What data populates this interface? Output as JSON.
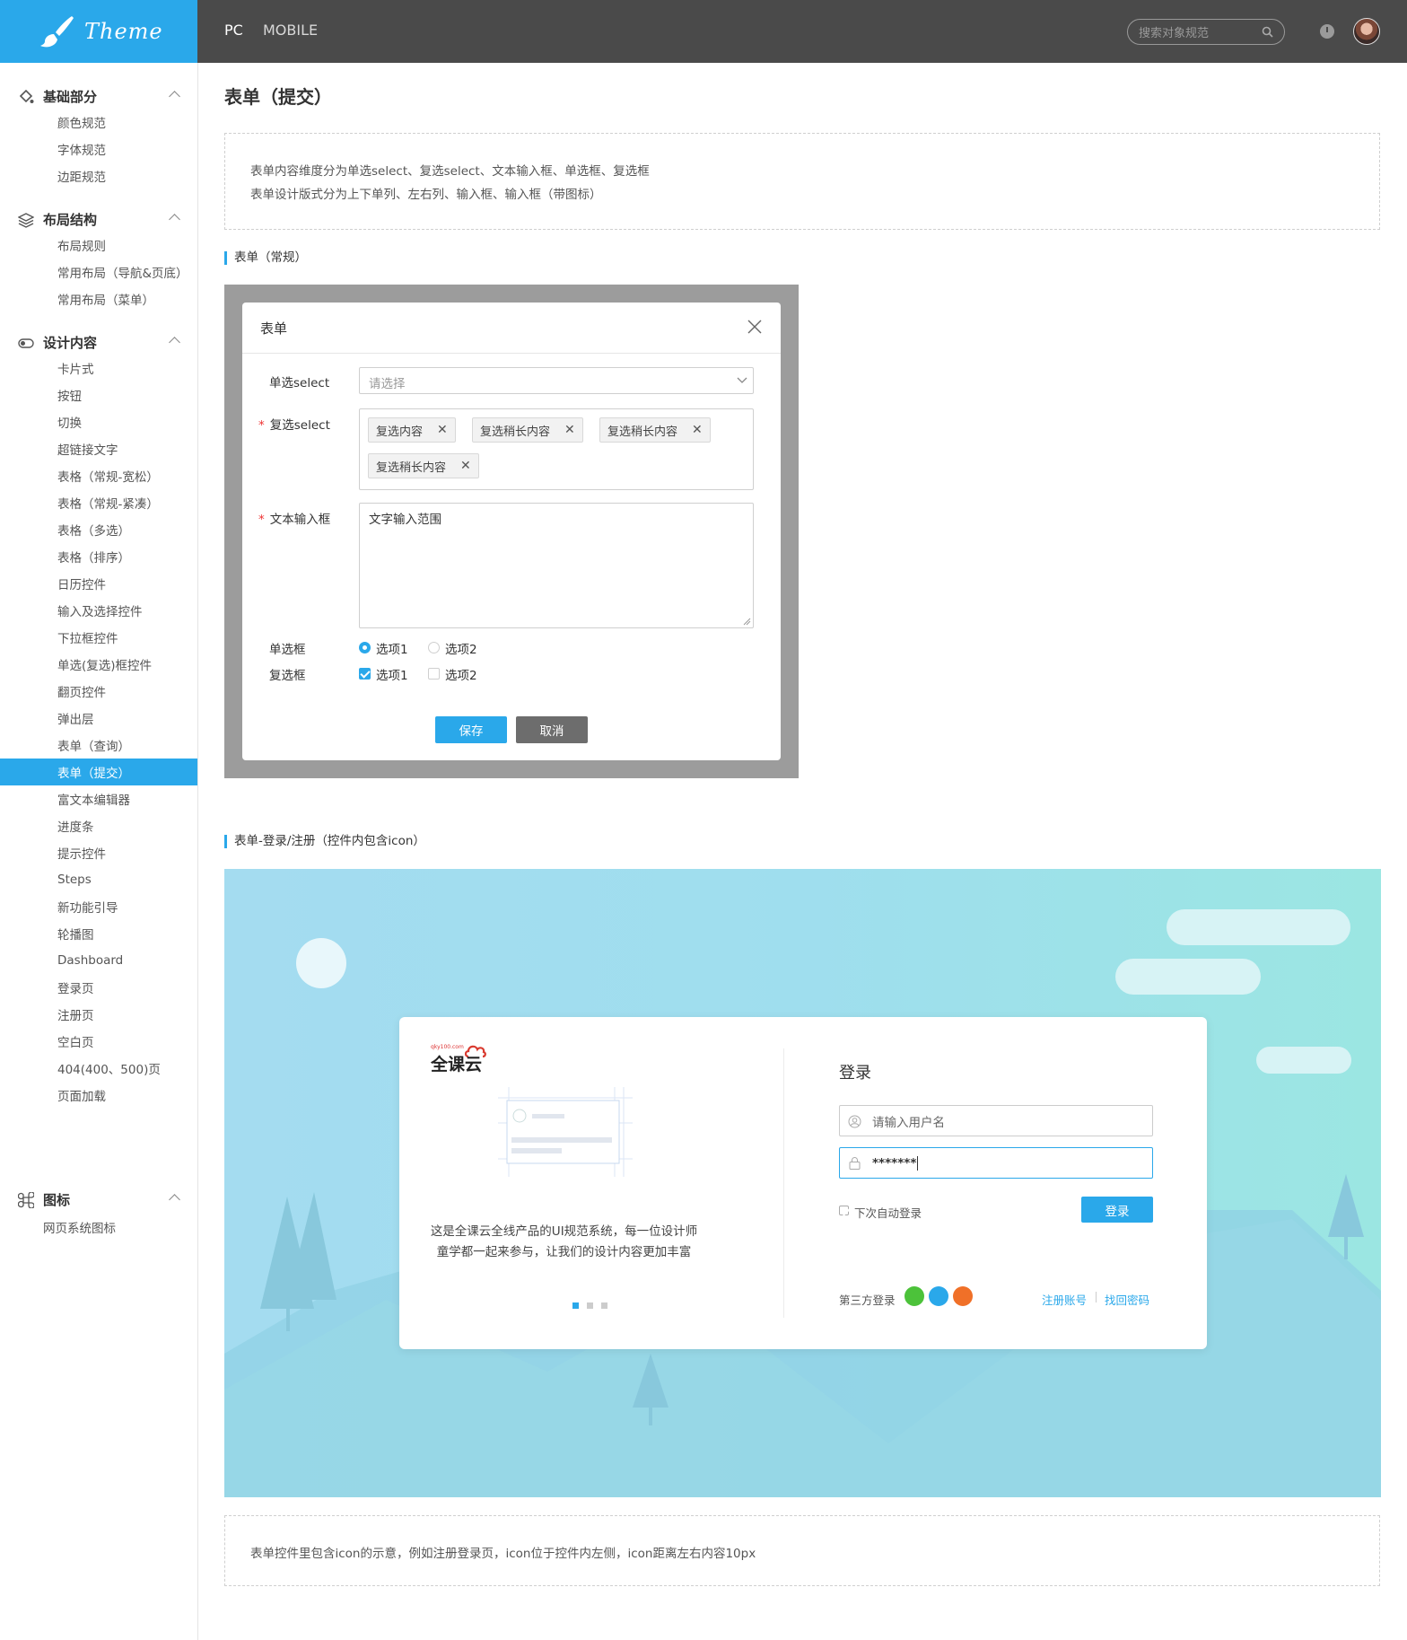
{
  "app": {
    "logo_text": "Theme"
  },
  "topbar": {
    "tabs": [
      {
        "label": "PC"
      },
      {
        "label": "MOBILE"
      }
    ],
    "search_placeholder": "搜索对象规范"
  },
  "sidebar": {
    "groups": [
      {
        "title": "基础部分",
        "items": [
          "颜色规范",
          "字体规范",
          "边距规范"
        ]
      },
      {
        "title": "布局结构",
        "items": [
          "布局规则",
          "常用布局（导航&页底）",
          "常用布局（菜单）"
        ]
      },
      {
        "title": "设计内容",
        "items": [
          "卡片式",
          "按钮",
          "切换",
          "超链接文字",
          "表格（常规-宽松）",
          "表格（常规-紧凑）",
          "表格（多选）",
          "表格（排序）",
          "日历控件",
          "输入及选择控件",
          "下拉框控件",
          "单选(复选)框控件",
          "翻页控件",
          "弹出层",
          "表单（查询）",
          "表单（提交）",
          "富文本编辑器",
          "进度条",
          "提示控件",
          "Steps",
          "新功能引导",
          "轮播图",
          "Dashboard",
          "登录页",
          "注册页",
          "空白页",
          "404(400、500)页",
          "页面加载"
        ]
      },
      {
        "title": "图标",
        "items": [
          "网页系统图标"
        ]
      }
    ],
    "active_item": "表单（提交）"
  },
  "main": {
    "title": "表单（提交）",
    "intro": [
      "表单内容维度分为单选select、复选select、文本输入框、单选框、复选框",
      "表单设计版式分为上下单列、左右列、输入框、输入框（带图标）"
    ],
    "section1_title": "表单（常规）",
    "dialog": {
      "title": "表单",
      "single_select_label": "单选select",
      "single_select_placeholder": "请选择",
      "multi_select_label": "复选select",
      "tags": [
        "复选内容",
        "复选稍长内容",
        "复选稍长内容",
        "复选稍长内容"
      ],
      "textarea_label": "文本输入框",
      "textarea_value": "文字输入范围",
      "radio_label": "单选框",
      "radio_options": [
        "选项1",
        "选项2"
      ],
      "radio_selected": 0,
      "checkbox_label": "复选框",
      "checkbox_options": [
        "选项1",
        "选项2"
      ],
      "checkbox_checked": [
        0
      ],
      "save_label": "保存",
      "cancel_label": "取消"
    },
    "section2_title": "表单-登录/注册（控件内包含icon）",
    "login": {
      "brand": "全课云",
      "brand_small": "qky100.com",
      "title": "登录",
      "username_placeholder": "请输入用户名",
      "password_value": "*******",
      "remember_label": "下次自动登录",
      "login_button": "登录",
      "third_party_label": "第三方登录",
      "register_link": "注册账号",
      "find_password_link": "找回密码",
      "description_line1": "这是全课云全线产品的UI规范系统，每一位设计师",
      "description_line2": "童学都一起来参与，让我们的设计内容更加丰富",
      "carousel_total": 3,
      "carousel_active": 0
    },
    "footer_note": "表单控件里包含icon的示意，例如注册登录页，icon位于控件内左侧，icon距离左右内容10px"
  },
  "colors": {
    "accent": "#2aa8ea",
    "topbar": "#4a4a4a",
    "overlay": "#9c9c9c",
    "cancel": "#6d6d6d"
  }
}
